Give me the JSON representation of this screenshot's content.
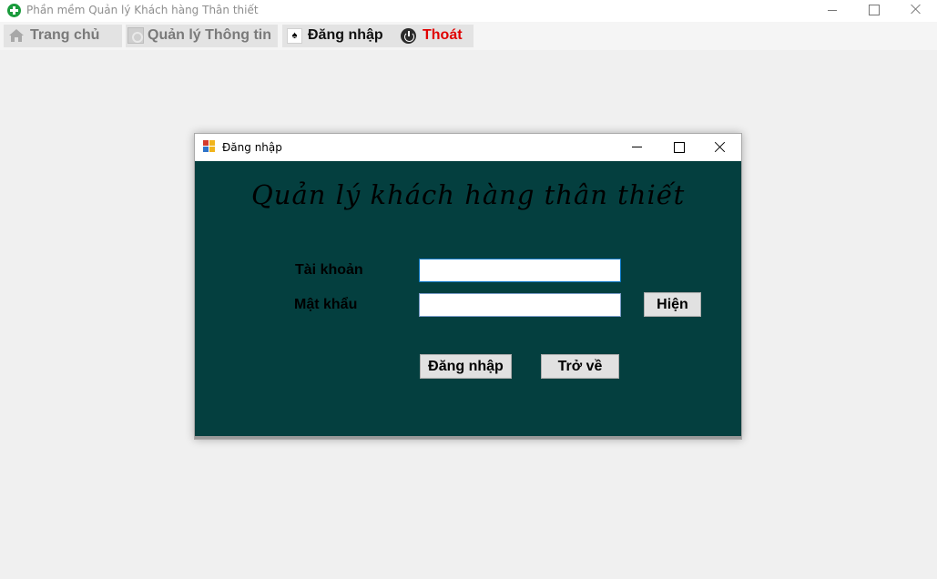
{
  "window": {
    "title": "Phần mềm Quản lý Khách hàng Thân thiết",
    "controls": {
      "minimize_icon": "minimize-icon",
      "maximize_icon": "maximize-icon",
      "close_icon": "close-icon"
    }
  },
  "menu": {
    "items": [
      {
        "label": "Trang chủ",
        "icon": "home-icon",
        "color": "#7a7a7a"
      },
      {
        "label": "Quản lý Thông tin",
        "icon": "info-icon",
        "color": "#7a7a7a"
      },
      {
        "label": "Đăng nhập",
        "icon": "login-icon",
        "color": "#111111"
      },
      {
        "label": "Thoát",
        "icon": "power-icon",
        "color": "#e00000"
      }
    ]
  },
  "dialog": {
    "title": "Đăng nhập",
    "heading": "Quản lý khách hàng thân thiết",
    "background": "#043f3f",
    "username": {
      "label": "Tài khoản",
      "value": ""
    },
    "password": {
      "label": "Mật khẩu",
      "value": ""
    },
    "show_button": "Hiện",
    "login_button": "Đăng nhập",
    "back_button": "Trở về"
  }
}
